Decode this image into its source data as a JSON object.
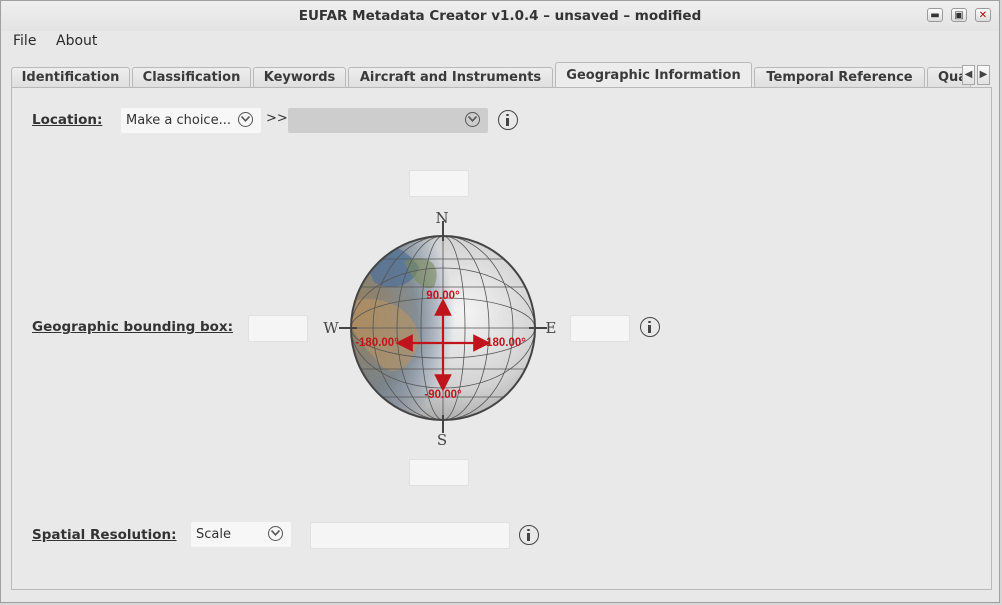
{
  "window": {
    "title": "EUFAR Metadata Creator v1.0.4 – unsaved – modified",
    "controls": {
      "minimize": "▬",
      "maximize": "▣",
      "close": "✕"
    }
  },
  "menu": {
    "file": "File",
    "about": "About"
  },
  "tabs": [
    {
      "label": "Identification",
      "active": false
    },
    {
      "label": "Classification",
      "active": false
    },
    {
      "label": "Keywords",
      "active": false
    },
    {
      "label": "Aircraft and Instruments",
      "active": false
    },
    {
      "label": "Geographic Information",
      "active": true
    },
    {
      "label": "Temporal Reference",
      "active": false
    },
    {
      "label": "Qua",
      "active": false
    }
  ],
  "tab_scroll": {
    "left": "◀",
    "right": "▶"
  },
  "location": {
    "label": "Location:",
    "combo_value": "Make a choice...",
    "separator": ">>",
    "sub_combo_value": ""
  },
  "bounding_box": {
    "label": "Geographic bounding box:",
    "north_value": "",
    "south_value": "",
    "west_value": "",
    "east_value": "",
    "compass": {
      "n": "N",
      "s": "S",
      "w": "W",
      "e": "E"
    },
    "lat_max": "90.00°",
    "lat_min": "-90.00°",
    "lon_min": "-180.00°",
    "lon_max": "180.00°"
  },
  "spatial_resolution": {
    "label": "Spatial Resolution:",
    "combo_value": "Scale",
    "value": ""
  },
  "colors": {
    "arrow_red": "#c0141c",
    "panel_bg": "#e9e9e9",
    "globe_ocean": "#4f6f99",
    "globe_land": "#9c7f57"
  }
}
